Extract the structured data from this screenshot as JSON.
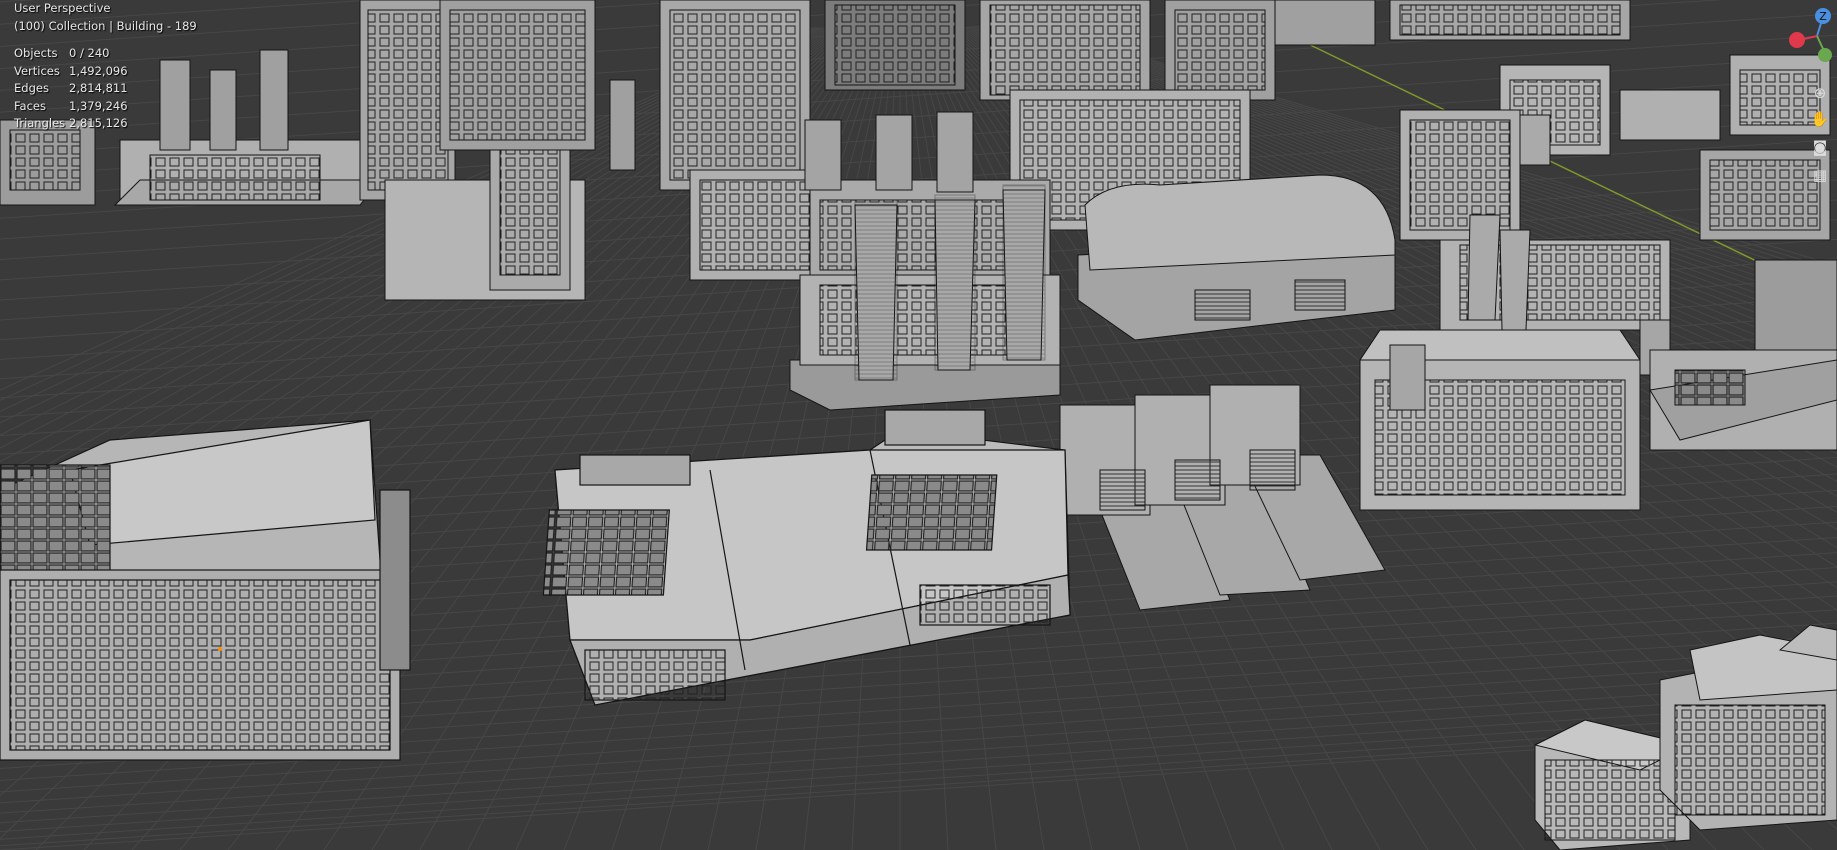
{
  "viewport": {
    "perspective_label": "User Perspective",
    "collection_label": "(100) Collection | Building - 189"
  },
  "stats": [
    {
      "label": "Objects",
      "value": "0 / 240"
    },
    {
      "label": "Vertices",
      "value": "1,492,096"
    },
    {
      "label": "Edges",
      "value": "2,814,811"
    },
    {
      "label": "Faces",
      "value": "1,379,246"
    },
    {
      "label": "Triangles",
      "value": "2,815,126"
    }
  ],
  "gizmo": {
    "z_label": "Z",
    "x_color": "#e0394b",
    "y_color": "#6aa84f",
    "z_color": "#4a8fe2"
  },
  "nav_icons": [
    "zoom-icon",
    "hand-pan-icon",
    "camera-icon",
    "grid-icon"
  ],
  "colors": {
    "background": "#3a3a3a",
    "grid_line": "#4a4a4a",
    "building_light": "#b6b6b6",
    "building_mid": "#9c9c9c",
    "building_dark": "#7c7c7c",
    "axis_line": "#7f9a2a"
  }
}
